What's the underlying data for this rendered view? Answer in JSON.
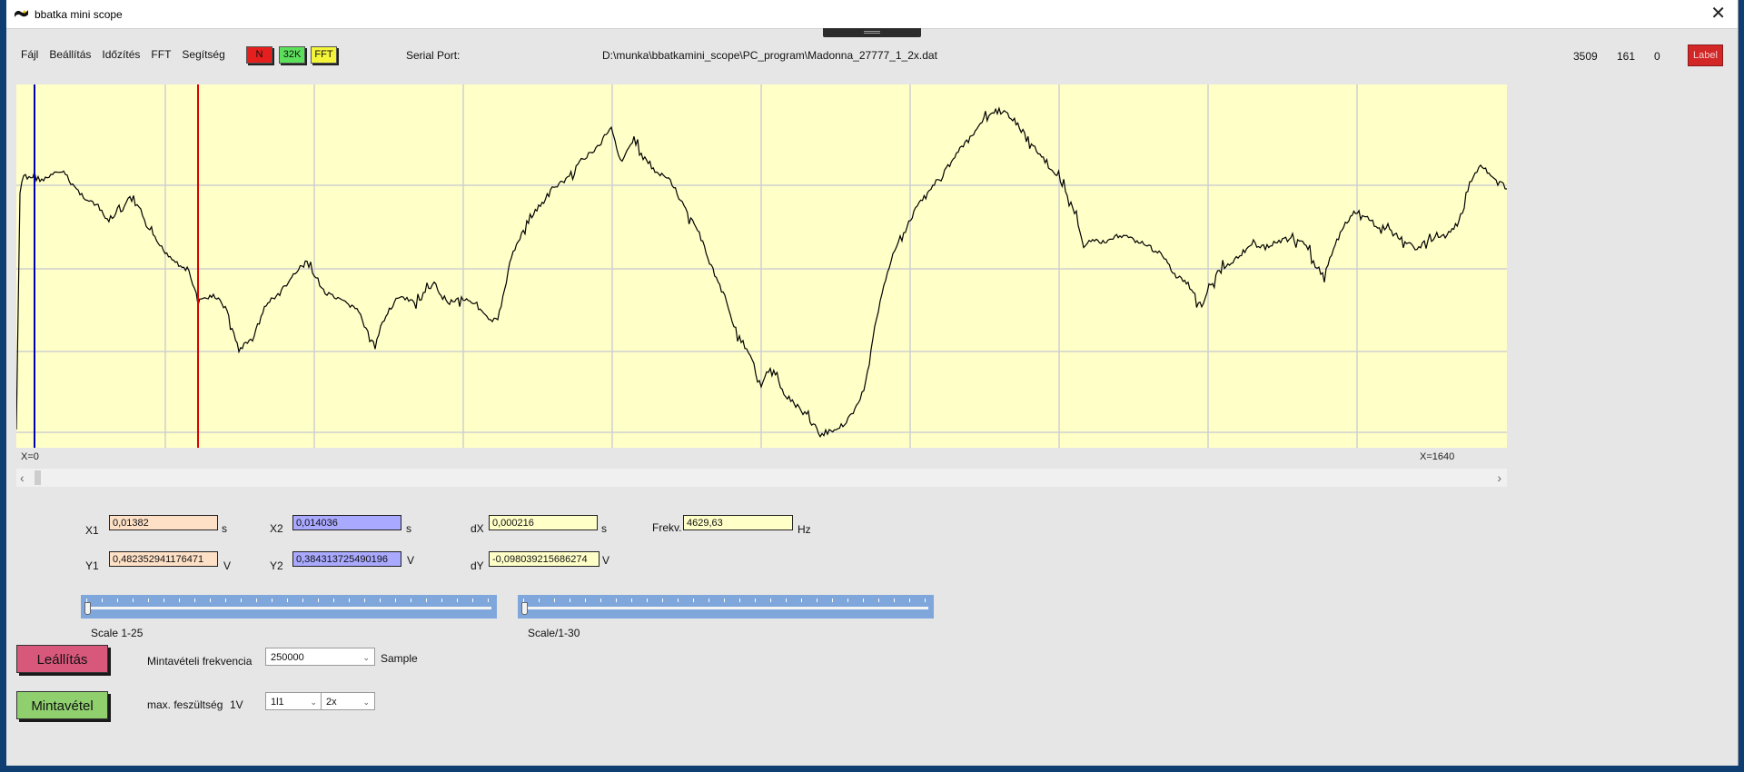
{
  "window": {
    "title": "bbatka mini scope",
    "close_glyph": "✕"
  },
  "menu": [
    "Fájl",
    "Beállítás",
    "Időzítés",
    "FFT",
    "Segítség"
  ],
  "tags": {
    "n": "N",
    "k32": "32K",
    "fft": "FFT"
  },
  "serial": {
    "label": "Serial Port:",
    "path": "D:\\munka\\bbatkamini_scope\\PC_program\\Madonna_27777_1_2x.dat"
  },
  "status": {
    "a": "3509",
    "b": "161",
    "c": "0",
    "label_button": "Label"
  },
  "plot": {
    "x_start_label": "X=0",
    "x_end_label": "X=1640",
    "background": "#ffffc8",
    "trace_color": "#000000",
    "cursor1_color": "#0000aa",
    "cursor2_color": "#dd0000",
    "grid_color": "#cfcfcf"
  },
  "scroll": {
    "left_arrow": "‹",
    "right_arrow": "›"
  },
  "measure": {
    "x1": {
      "label": "X1",
      "value": "0,01382",
      "unit": "s"
    },
    "x2": {
      "label": "X2",
      "value": "0,014036",
      "unit": "s"
    },
    "dx": {
      "label": "dX",
      "value": "0,000216",
      "unit": "s"
    },
    "freq": {
      "label": "Frekv.",
      "value": "4629,63",
      "unit": "Hz"
    },
    "y1": {
      "label": "Y1",
      "value": "0,482352941176471",
      "unit": "V"
    },
    "y2": {
      "label": "Y2",
      "value": "0,384313725490196",
      "unit": "V"
    },
    "dy": {
      "label": "dY",
      "value": "-0,098039215686274",
      "unit": "V"
    }
  },
  "sliders": {
    "scale1_label": "Scale 1-25",
    "scale2_label": "Scale/1-30"
  },
  "controls": {
    "stop_button": "Leállítás",
    "sample_button": "Mintavétel",
    "sample_freq_label": "Mintavételi frekvencia",
    "sample_freq_value": "250000",
    "sample_unit": "Sample",
    "max_voltage_label": "max. feszültség",
    "max_voltage_value": "1V",
    "ratio_value": "1l1",
    "mult_value": "2x"
  },
  "colors": {
    "stop_btn": "#d8587b",
    "sample_btn": "#8fcf6e",
    "tag_n": "#e51e1e",
    "tag_32k": "#5ce05c",
    "tag_fft": "#f4f43a"
  }
}
